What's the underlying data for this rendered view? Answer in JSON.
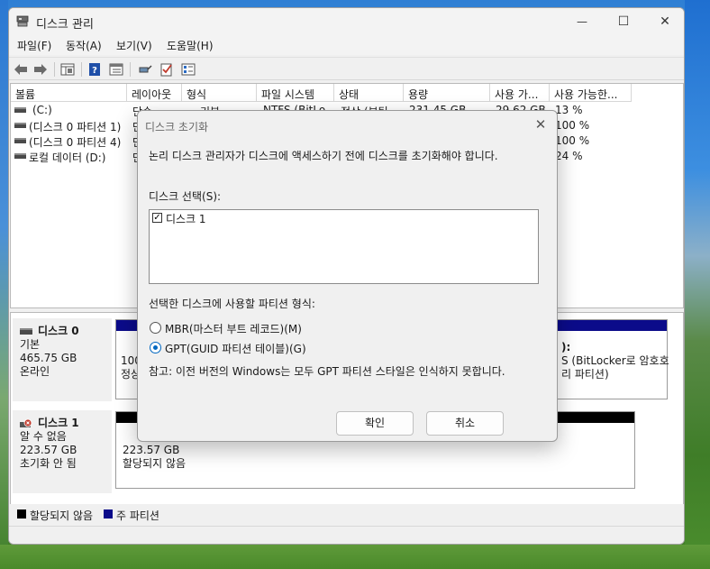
{
  "window": {
    "title": "디스크 관리",
    "controls": {
      "minimize": "—",
      "maximize": "☐",
      "close": "✕"
    }
  },
  "menu": [
    "파일(F)",
    "동작(A)",
    "보기(V)",
    "도움말(H)"
  ],
  "toolbar": {
    "icons": [
      "back-arrow-icon",
      "forward-arrow-icon",
      "properties-grid-icon",
      "help-icon",
      "view-list-icon",
      "connect-icon",
      "checklist-icon",
      "settings-list-icon"
    ]
  },
  "volumes": {
    "columns": [
      "볼륨",
      "레이아웃",
      "형식",
      "파일 시스템",
      "상태",
      "용량",
      "사용 가...",
      "사용 가능한..."
    ],
    "rows": [
      [
        "(C:)",
        "단순",
        "기본",
        "NTFS (BitLo...",
        "정상 (부팅...",
        "231.45 GB",
        "29.62 GB",
        "13 %"
      ],
      [
        "(디스크 0 파티션 1)",
        "단",
        "",
        "",
        "",
        "",
        "",
        "100 %"
      ],
      [
        "(디스크 0 파티션 4)",
        "단",
        "",
        "",
        "",
        "",
        "",
        "100 %"
      ],
      [
        "로컬 데이터 (D:)",
        "단",
        "",
        "",
        "",
        "",
        "",
        "24 %"
      ]
    ]
  },
  "disks": [
    {
      "name": "디스크 0",
      "type": "기본",
      "size": "465.75 GB",
      "status": "온라인",
      "partition_left": {
        "line1": "100",
        "line2": "정상"
      },
      "partition_right": {
        "line1": "):",
        "line2": "S (BitLocker로 암호호",
        "line3": "리 파티션)"
      }
    },
    {
      "name": "디스크 1",
      "type": "알 수 없음",
      "size": "223.57 GB",
      "status": "초기화 안 됨",
      "unallocated": {
        "size": "223.57 GB",
        "label": "할당되지 않음"
      }
    }
  ],
  "legend": [
    {
      "label": "할당되지 않음",
      "color": "#000000"
    },
    {
      "label": "주 파티션",
      "color": "#0b0b8a"
    }
  ],
  "dialog": {
    "title": "디스크 초기화",
    "close": "✕",
    "description": "논리 디스크 관리자가 디스크에 액세스하기 전에 디스크를 초기화해야 합니다.",
    "select_label": "디스크 선택(S):",
    "disks": [
      {
        "label": "디스크 1",
        "checked": true
      }
    ],
    "style_label": "선택한 디스크에 사용할 파티션 형식:",
    "options": [
      {
        "label": "MBR(마스터 부트 레코드)(M)",
        "selected": false
      },
      {
        "label": "GPT(GUID 파티션 테이블)(G)",
        "selected": true
      }
    ],
    "note": "참고: 이전 버전의 Windows는 모두 GPT 파티션 스타일은 인식하지 못합니다.",
    "ok_label": "확인",
    "cancel_label": "취소"
  }
}
